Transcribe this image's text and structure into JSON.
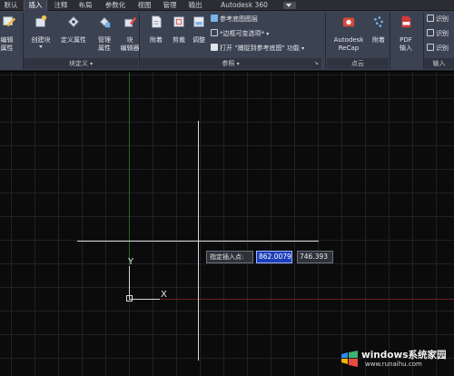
{
  "tabs": [
    "默认",
    "插入",
    "注释",
    "布局",
    "参数化",
    "视图",
    "管理",
    "输出",
    "Autodesk 360"
  ],
  "active_tab": "插入",
  "ribbon": {
    "block_panel": {
      "title": "块定义",
      "edit_attr": "编辑\n属性",
      "create_block": "创建块",
      "define_attr": "定义属性",
      "manage_attr": "管理\n属性",
      "block_editor": "块\n编辑器"
    },
    "reference_panel": {
      "title": "参照",
      "attach": "附着",
      "clip": "剪裁",
      "adjust": "调整",
      "underlay_layers": "参考底图图层",
      "frame_variable": "*边框可变选项*",
      "snap_underlay_prefix": "打开",
      "snap_underlay_quoted": "\"捕捉到参考底图\"",
      "snap_underlay_suffix": "功能"
    },
    "pointcloud_panel": {
      "title": "点云",
      "recap": "Autodesk\nReCap",
      "attach": "附着"
    },
    "import_panel": {
      "pdf": "PDF\n输入",
      "title": "输入"
    },
    "right_cut": {
      "row1": "识别",
      "row2": "识别",
      "row3": "识别"
    }
  },
  "drawing": {
    "ucs_x": "X",
    "ucs_y": "Y",
    "prompt": "指定插入点:",
    "x_value": "862.0079",
    "y_value": "746.393"
  },
  "colors": {
    "tab_active": "#3b4150",
    "ribbon_bg": "#3b4252",
    "canvas_bg": "#0b0b0c",
    "grid": "#1f2124",
    "y_axis_green": "#1f6a2a",
    "x_axis_red": "#6a1f22",
    "crosshair": "#d8d8d8",
    "dyn_input_highlight": "#1d3fb7"
  },
  "watermark": {
    "title": "windows系统家园",
    "sub": "www.runaihu.com"
  }
}
